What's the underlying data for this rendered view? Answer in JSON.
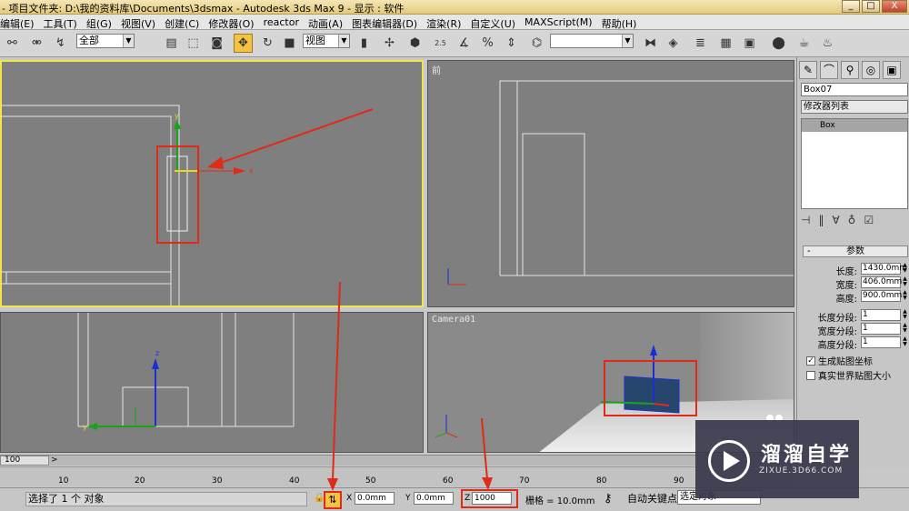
{
  "window": {
    "title": "- 项目文件夹: D:\\我的资料库\\Documents\\3dsmax    - Autodesk 3ds Max 9    - 显示 : 软件",
    "buttons": [
      "_",
      "□",
      "X"
    ]
  },
  "menu": [
    "编辑(E)",
    "工具(T)",
    "组(G)",
    "视图(V)",
    "创建(C)",
    "修改器(O)",
    "reactor",
    "动画(A)",
    "图表编辑器(D)",
    "渲染(R)",
    "自定义(U)",
    "MAXScript(M)",
    "帮助(H)"
  ],
  "toolbar": {
    "selection_filter": "全部",
    "ref_coord": "视图",
    "named_sel": "",
    "snap_label": "2.5"
  },
  "viewports": {
    "top": {
      "label": ""
    },
    "front": {
      "label": "前"
    },
    "left": {
      "label": ""
    },
    "camera": {
      "label": "Camera01"
    }
  },
  "command_panel": {
    "object_name": "Box07",
    "modifier_list": "修改器列表",
    "stack_item": "Box",
    "rollout_title": "参数",
    "params": [
      {
        "label": "长度:",
        "value": "1430.0mm"
      },
      {
        "label": "宽度:",
        "value": "406.0mm"
      },
      {
        "label": "高度:",
        "value": "900.0mm"
      },
      {
        "label": "长度分段:",
        "value": "1"
      },
      {
        "label": "宽度分段:",
        "value": "1"
      },
      {
        "label": "高度分段:",
        "value": "1"
      }
    ],
    "checkboxes": [
      {
        "label": "生成贴图坐标",
        "checked": true
      },
      {
        "label": "真实世界贴图大小",
        "checked": false
      }
    ]
  },
  "timeline": {
    "frame_slider": "100",
    "next": ">",
    "ticks": [
      "10",
      "20",
      "30",
      "40",
      "50",
      "60",
      "70",
      "80",
      "90"
    ]
  },
  "status": {
    "message": "选择了 1 个 对象",
    "x_label": "X",
    "x_value": "0.0mm",
    "y_label": "Y",
    "y_value": "0.0mm",
    "z_label": "Z",
    "z_value": "1000",
    "grid": "栅格 = 10.0mm",
    "autokey": "自动关键点",
    "setkey_value": "选定对象"
  },
  "watermark": {
    "brand": "溜溜自学",
    "url": "ZIXUE.3D66.COM"
  },
  "colors": {
    "viewport_bg": "#7f7f7f",
    "active_border": "#f2e54a",
    "annotation_red": "#e02a1a",
    "gizmo_blue": "#1a2fd0",
    "gizmo_green": "#1aa31a",
    "gizmo_yellow": "#e8d81a"
  }
}
